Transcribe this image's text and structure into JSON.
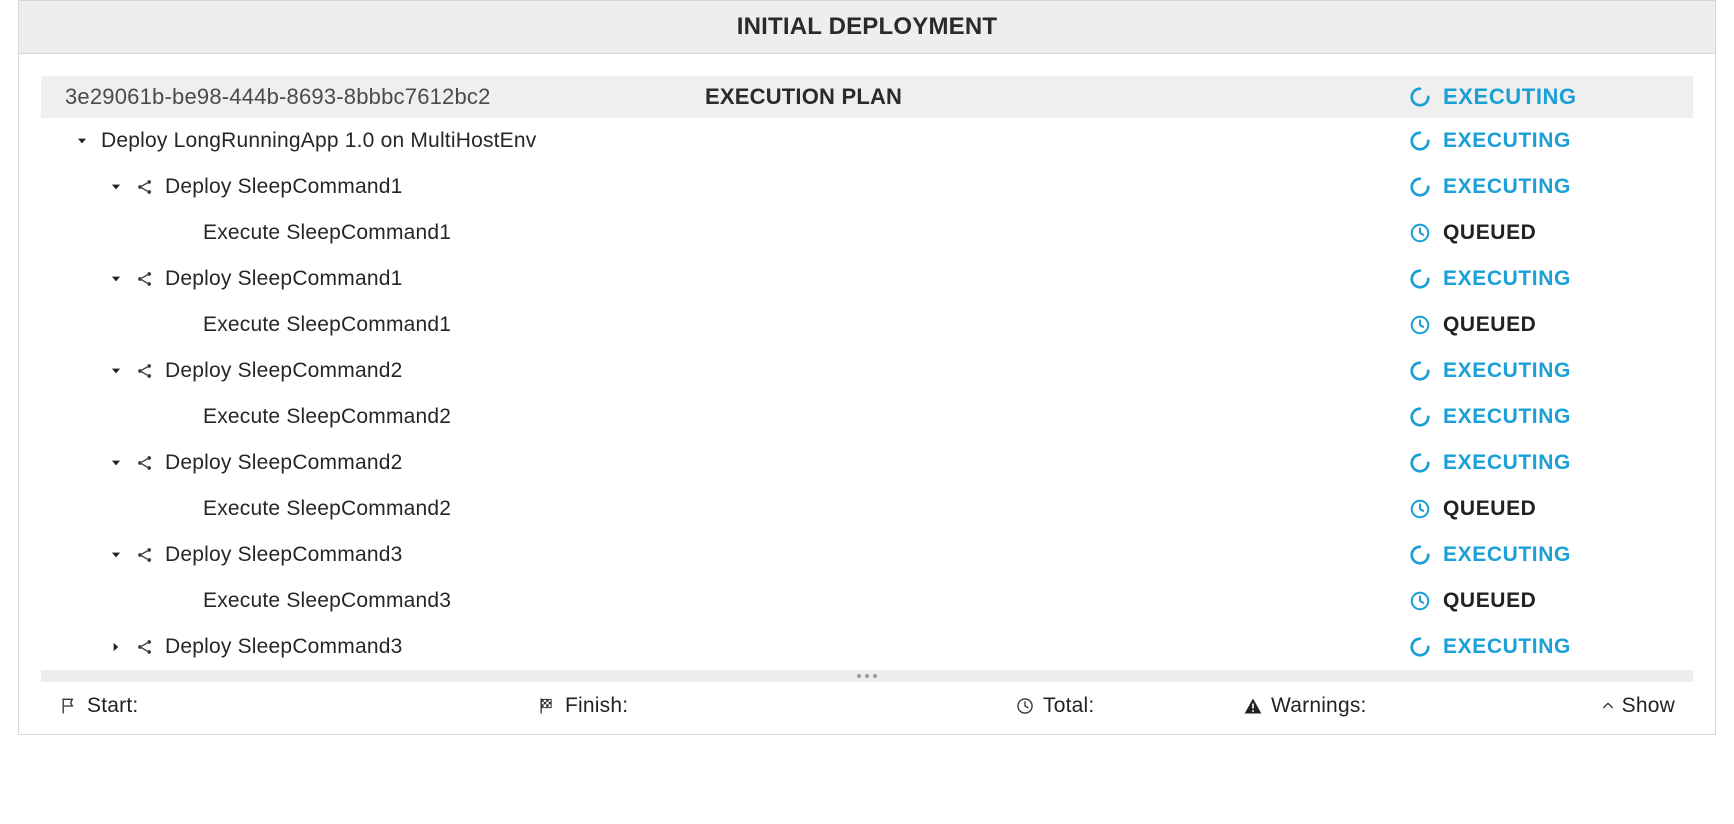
{
  "colors": {
    "accent": "#1a9fd6",
    "queued": "#222222"
  },
  "header": {
    "title": "INITIAL DEPLOYMENT"
  },
  "plan": {
    "uuid": "3e29061b-be98-444b-8693-8bbbc7612bc2",
    "title": "EXECUTION PLAN",
    "status": "EXECUTING"
  },
  "rows": [
    {
      "indent": 0,
      "toggle": "down",
      "share": false,
      "label": "Deploy LongRunningApp 1.0 on MultiHostEnv",
      "status": "EXECUTING"
    },
    {
      "indent": 1,
      "toggle": "down",
      "share": true,
      "label": "Deploy SleepCommand1",
      "status": "EXECUTING"
    },
    {
      "indent": 2,
      "toggle": "none",
      "share": false,
      "label": "Execute SleepCommand1",
      "status": "QUEUED"
    },
    {
      "indent": 1,
      "toggle": "down",
      "share": true,
      "label": "Deploy SleepCommand1",
      "status": "EXECUTING"
    },
    {
      "indent": 2,
      "toggle": "none",
      "share": false,
      "label": "Execute SleepCommand1",
      "status": "QUEUED"
    },
    {
      "indent": 1,
      "toggle": "down",
      "share": true,
      "label": "Deploy SleepCommand2",
      "status": "EXECUTING"
    },
    {
      "indent": 2,
      "toggle": "none",
      "share": false,
      "label": "Execute SleepCommand2",
      "status": "EXECUTING"
    },
    {
      "indent": 1,
      "toggle": "down",
      "share": true,
      "label": "Deploy SleepCommand2",
      "status": "EXECUTING"
    },
    {
      "indent": 2,
      "toggle": "none",
      "share": false,
      "label": "Execute SleepCommand2",
      "status": "QUEUED"
    },
    {
      "indent": 1,
      "toggle": "down",
      "share": true,
      "label": "Deploy SleepCommand3",
      "status": "EXECUTING"
    },
    {
      "indent": 2,
      "toggle": "none",
      "share": false,
      "label": "Execute SleepCommand3",
      "status": "QUEUED"
    },
    {
      "indent": 1,
      "toggle": "right",
      "share": true,
      "label": "Deploy SleepCommand3",
      "status": "EXECUTING"
    }
  ],
  "footer": {
    "start_label": "Start:",
    "start_value": "",
    "finish_label": "Finish:",
    "finish_value": "",
    "total_label": "Total:",
    "total_value": "",
    "warnings_label": "Warnings:",
    "warnings_value": "",
    "show_label": "Show"
  }
}
